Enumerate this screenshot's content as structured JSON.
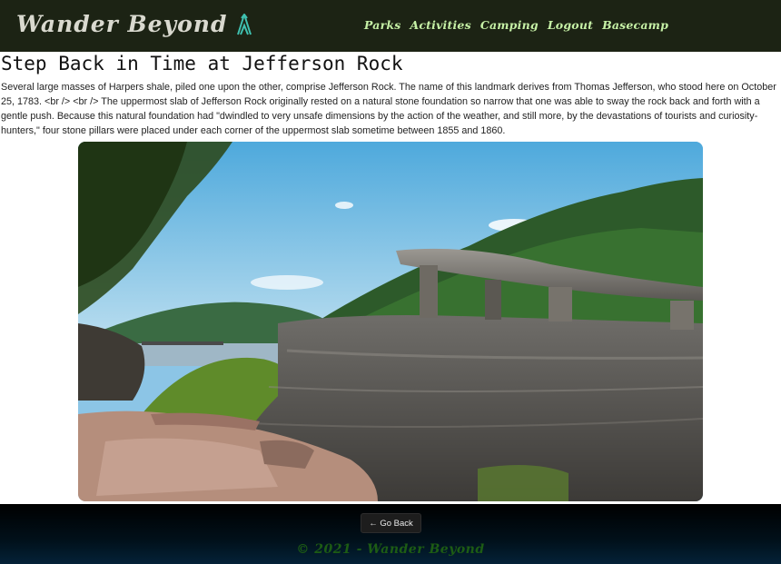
{
  "header": {
    "brand": "Wander Beyond",
    "brand_icon": "tent-icon",
    "nav": [
      {
        "label": "Parks"
      },
      {
        "label": "Activities"
      },
      {
        "label": "Camping"
      },
      {
        "label": "Logout"
      },
      {
        "label": "Basecamp"
      }
    ]
  },
  "article": {
    "title": "Step Back in Time at Jefferson Rock",
    "body": "Several large masses of Harpers shale, piled one upon the other, comprise Jefferson Rock. The name of this landmark derives from Thomas Jefferson, who stood here on October 25, 1783. <br /> <br /> The uppermost slab of Jefferson Rock originally rested on a natural stone foundation so narrow that one was able to sway the rock back and forth with a gentle push. Because this natural foundation had \"dwindled to very unsafe dimensions by the action of the weather, and still more, by the devastations of tourists and curiosity-hunters,\" four stone pillars were placed under each corner of the uppermost slab sometime between 1855 and 1860."
  },
  "footer": {
    "back_label": "← Go Back",
    "copyright": "© 2021 - Wander Beyond"
  },
  "colors": {
    "header_bg": "#1c2314",
    "nav_text": "#c6f1a6",
    "footer_text": "#1d5c14",
    "accent_tent": "#3fc1b0"
  }
}
